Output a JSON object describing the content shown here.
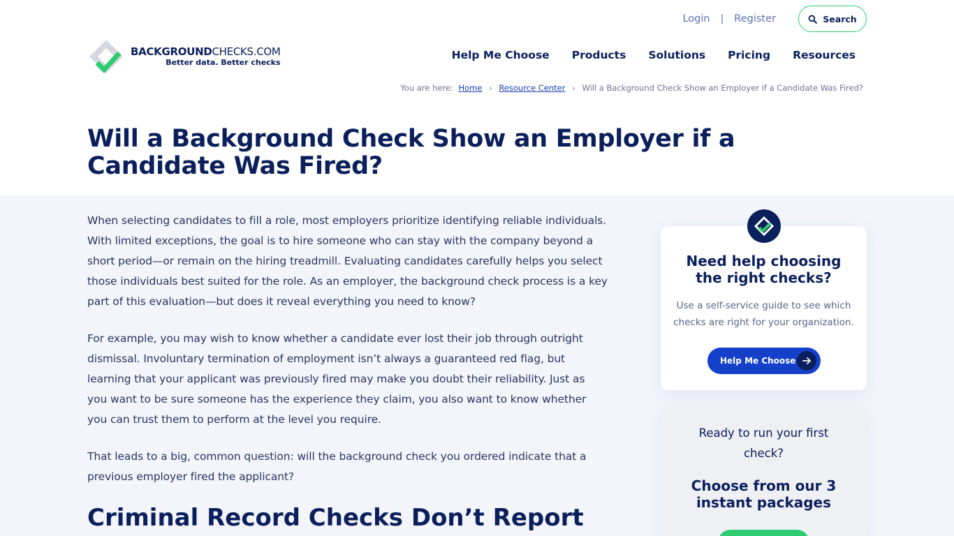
{
  "header": {
    "login": "Login",
    "separator": "|",
    "register": "Register",
    "search_label": "Search",
    "logo": {
      "name_bold": "BACKGROUND",
      "name_rest": "CHECKS.COM",
      "tagline": "Better data. Better checks"
    },
    "nav": [
      "Help Me Choose",
      "Products",
      "Solutions",
      "Pricing",
      "Resources"
    ]
  },
  "breadcrumb": {
    "prefix": "You are here:",
    "items": [
      "Home",
      "Resource Center",
      "Will a Background Check Show an Employer if a Candidate Was Fired?"
    ],
    "sep": "›"
  },
  "page": {
    "title": "Will a Background Check Show an Employer if a Candidate Was Fired?"
  },
  "article": {
    "paragraphs": [
      "When selecting candidates to fill a role, most employers prioritize identifying reliable individuals. With limited exceptions, the goal is to hire someone who can stay with the company beyond a short period—or remain on the hiring treadmill. Evaluating candidates carefully helps you select those individuals best suited for the role. As an employer, the background check process is a key part of this evaluation—but does it reveal everything you need to know?",
      "For example, you may wish to know whether a candidate ever lost their job through outright dismissal. Involuntary termination of employment isn’t always a guaranteed red flag, but learning that your applicant was previously fired may make you doubt their reliability. Just as you want to be sure someone has the experience they claim, you also want to know whether you can trust them to perform at the level you require.",
      "That leads to a big, common question: will the background check you ordered indicate that a previous employer fired the applicant?"
    ],
    "subheading": "Criminal Record Checks Don’t Report"
  },
  "sidebar": {
    "help_card": {
      "title": "Need help choosing the right checks?",
      "text": "Use a self-service guide to see which checks are right for your organization.",
      "button": "Help Me Choose"
    },
    "packages_card": {
      "intro": "Ready to run your first check?",
      "title": "Choose from our 3 instant packages"
    }
  },
  "colors": {
    "navy": "#0a1f5c",
    "accent_blue": "#1540c9",
    "accent_green": "#2ecc71",
    "content_bg": "#f3f5fb"
  }
}
